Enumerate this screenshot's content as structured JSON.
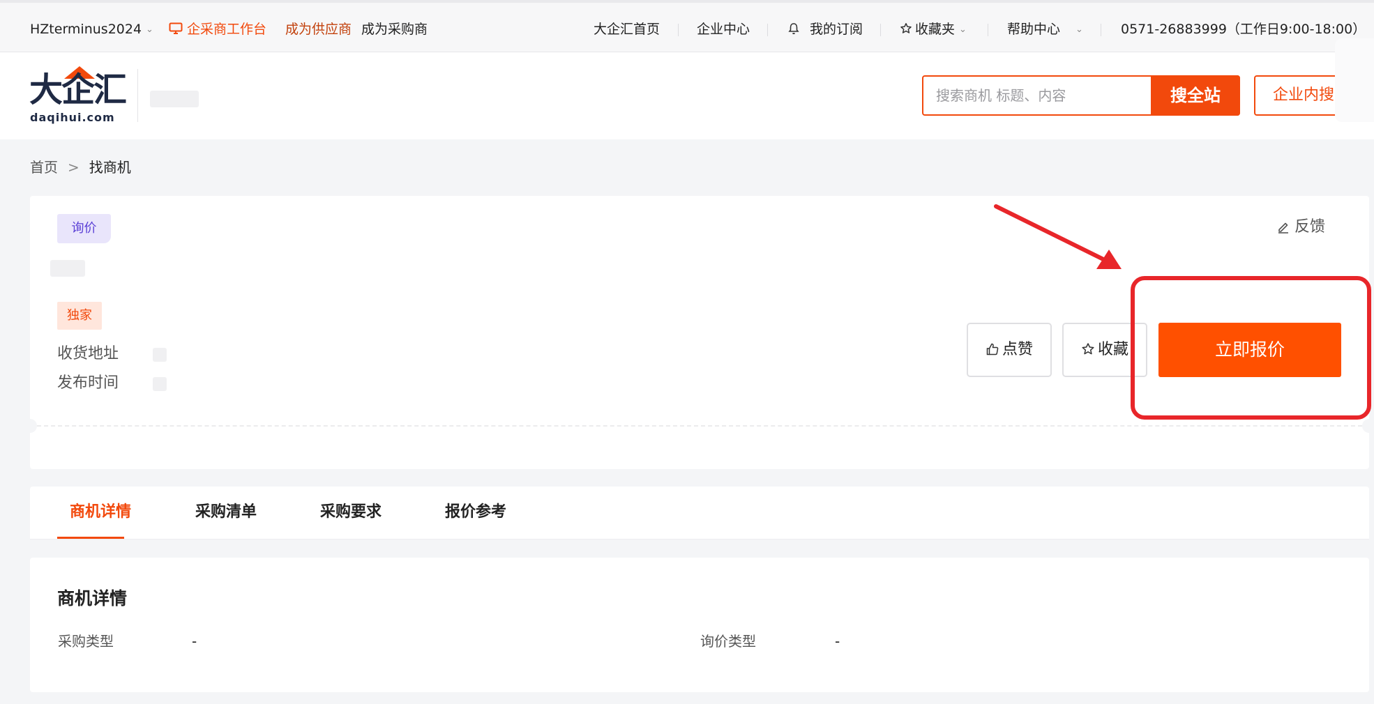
{
  "topbar": {
    "user": "HZterminus2024",
    "workbench": "企采商工作台",
    "become_supplier": "成为供应商",
    "become_buyer": "成为采购商",
    "home": "大企汇首页",
    "enterprise_center": "企业中心",
    "subscriptions": "我的订阅",
    "favorites": "收藏夹",
    "help_center": "帮助中心",
    "phone": "0571-26883999（工作日9:00-18:00）"
  },
  "header": {
    "logo_text": "大企汇",
    "logo_sub": "daqihui.com",
    "search_placeholder": "搜索商机 标题、内容",
    "search_button": "搜全站",
    "inner_search_button": "企业内搜索"
  },
  "breadcrumb": {
    "home": "首页",
    "separator": ">",
    "current": "找商机"
  },
  "opportunity": {
    "type_tag": "询价",
    "exclusive_tag": "独家",
    "address_label": "收货地址",
    "publish_time_label": "发布时间",
    "feedback": "反馈",
    "like_button": "点赞",
    "favorite_button": "收藏",
    "quote_button": "立即报价"
  },
  "tabs": [
    {
      "label": "商机详情",
      "active": true
    },
    {
      "label": "采购清单",
      "active": false
    },
    {
      "label": "采购要求",
      "active": false
    },
    {
      "label": "报价参考",
      "active": false
    }
  ],
  "details": {
    "title": "商机详情",
    "purchase_type_label": "采购类型",
    "purchase_type_value": "-",
    "inquiry_type_label": "询价类型",
    "inquiry_type_value": "-"
  },
  "colors": {
    "accent": "#f2490c",
    "quote_button": "#ff5000",
    "annotation": "#e8262a",
    "inquiry_tag_bg": "#e9e5fb"
  }
}
